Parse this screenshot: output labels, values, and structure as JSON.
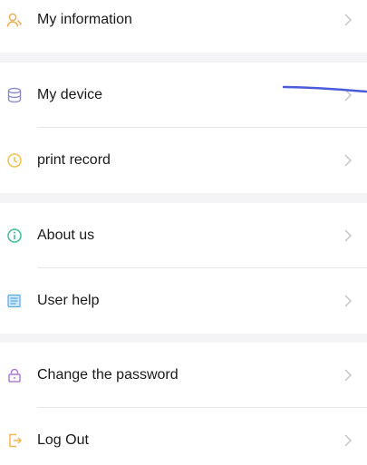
{
  "menu": {
    "my_information": {
      "label": "My information",
      "icon": "user-icon",
      "icon_color": "#e8b15a"
    },
    "my_device": {
      "label": "My device",
      "icon": "database-icon",
      "icon_color": "#8a8fc9"
    },
    "print_record": {
      "label": "print record",
      "icon": "clock-icon",
      "icon_color": "#f2c14e"
    },
    "about_us": {
      "label": "About us",
      "icon": "info-icon",
      "icon_color": "#3fbf9a"
    },
    "user_help": {
      "label": "User help",
      "icon": "document-icon",
      "icon_color": "#5aa9e6"
    },
    "change_password": {
      "label": "Change the password",
      "icon": "lock-icon",
      "icon_color": "#b07cd6"
    },
    "log_out": {
      "label": "Log Out",
      "icon": "logout-icon",
      "icon_color": "#f2b84b"
    }
  },
  "colors": {
    "background": "#f4f4f6",
    "card": "#ffffff",
    "chevron": "#c4c4c8",
    "annotation_stroke": "#4a5bdc"
  }
}
